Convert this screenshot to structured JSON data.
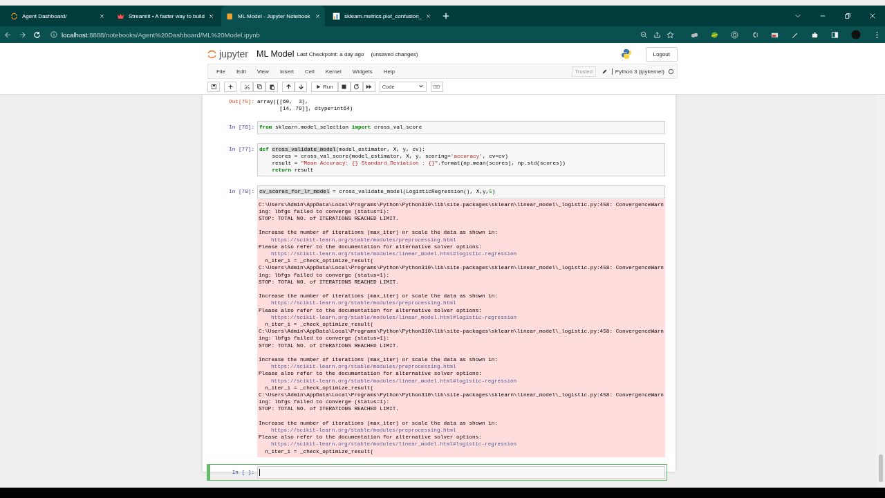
{
  "browser": {
    "tabs": [
      {
        "title": "Agent Dashboard/",
        "selected": false
      },
      {
        "title": "Streamlit • A faster way to build",
        "selected": false
      },
      {
        "title": "ML Model - Jupyter Notebook",
        "selected": true
      },
      {
        "title": "sklearn.metrics.plot_confusion_",
        "selected": false
      }
    ],
    "address": {
      "host": "localhost",
      "path": ":8888/notebooks/Agent%20Dashboard/ML%20Model.ipynb"
    }
  },
  "notebook": {
    "logo": "jupyter",
    "name": "ML Model",
    "checkpoint": "Last Checkpoint: a day ago",
    "unsaved": "(unsaved changes)",
    "logout": "Logout",
    "menu": [
      "File",
      "Edit",
      "View",
      "Insert",
      "Cell",
      "Kernel",
      "Widgets",
      "Help"
    ],
    "trusted": "Trusted",
    "kernel": "Python 3 (ipykernel)",
    "run": "Run",
    "cell_type": "Code"
  },
  "cells": [
    {
      "kind": "output",
      "prompt": "Out[75]:",
      "lines": [
        "array([[60,  3],",
        "       [14, 79]], dtype=int64)"
      ]
    },
    {
      "kind": "code",
      "prompt": "In [76]:",
      "selected": false,
      "lines": [
        [
          {
            "kind": "kw",
            "text": "from"
          },
          {
            "kind": "plain",
            "text": " sklearn.model_selection "
          },
          {
            "kind": "kw",
            "text": "import"
          },
          {
            "kind": "plain",
            "text": " cross_val_score"
          }
        ]
      ]
    },
    {
      "kind": "code",
      "prompt": "In [77]:",
      "selected": false,
      "lines": [
        [
          {
            "kind": "kw",
            "text": "def "
          },
          {
            "kind": "mark",
            "text": "cross_validate_model"
          },
          {
            "kind": "plain",
            "text": "(model_estimator, X, y, cv):"
          }
        ],
        [
          {
            "kind": "plain",
            "text": "    scores = cross_val_score(model_estimator, X, y, scoring="
          },
          {
            "kind": "str",
            "text": "'accuracy'"
          },
          {
            "kind": "plain",
            "text": ", cv=cv)"
          }
        ],
        [
          {
            "kind": "plain",
            "text": "    result = "
          },
          {
            "kind": "str",
            "text": "\"Mean Accuracy: {} Standard_Deviation : {}\""
          },
          {
            "kind": "plain",
            "text": ".format(np.mean(scores), np.std(scores))"
          }
        ],
        [
          {
            "kind": "kw",
            "text": "    return"
          },
          {
            "kind": "plain",
            "text": " result"
          }
        ]
      ]
    },
    {
      "kind": "code",
      "prompt": "In [78]:",
      "selected": false,
      "lines": [
        [
          {
            "kind": "mark",
            "text": "cv_scores_for_lr_model"
          },
          {
            "kind": "plain",
            "text": " = cross_validate_model(LogisticRegression(), X,y,"
          },
          {
            "kind": "num",
            "text": "5"
          },
          {
            "kind": "plain",
            "text": ")"
          }
        ]
      ],
      "stderr": [
        {
          "kind": "text",
          "text": "C:\\Users\\Admin\\AppData\\Local\\Programs\\Python\\Python310\\lib\\site-packages\\sklearn\\linear_model\\_logistic.py:458: ConvergenceWarn"
        },
        {
          "kind": "text",
          "text": "ing: lbfgs failed to converge (status=1):"
        },
        {
          "kind": "text",
          "text": "STOP: TOTAL NO. of ITERATIONS REACHED LIMIT."
        },
        {
          "kind": "spaced",
          "text": "Increase the number of iterations (max_iter) or scale the data as shown in:"
        },
        {
          "kind": "link",
          "text": "https://scikit-learn.org/stable/modules/preprocessing.html"
        },
        {
          "kind": "text",
          "text": "Please also refer to the documentation for alternative solver options:"
        },
        {
          "kind": "link",
          "text": "https://scikit-learn.org/stable/modules/linear_model.html#logistic-regression"
        },
        {
          "kind": "text",
          "text": "  n_iter_i = _check_optimize_result("
        },
        {
          "kind": "text",
          "text": "C:\\Users\\Admin\\AppData\\Local\\Programs\\Python\\Python310\\lib\\site-packages\\sklearn\\linear_model\\_logistic.py:458: ConvergenceWarn"
        },
        {
          "kind": "text",
          "text": "ing: lbfgs failed to converge (status=1):"
        },
        {
          "kind": "text",
          "text": "STOP: TOTAL NO. of ITERATIONS REACHED LIMIT."
        },
        {
          "kind": "spaced",
          "text": "Increase the number of iterations (max_iter) or scale the data as shown in:"
        },
        {
          "kind": "link",
          "text": "https://scikit-learn.org/stable/modules/preprocessing.html"
        },
        {
          "kind": "text",
          "text": "Please also refer to the documentation for alternative solver options:"
        },
        {
          "kind": "link",
          "text": "https://scikit-learn.org/stable/modules/linear_model.html#logistic-regression"
        },
        {
          "kind": "text",
          "text": "  n_iter_i = _check_optimize_result("
        },
        {
          "kind": "text",
          "text": "C:\\Users\\Admin\\AppData\\Local\\Programs\\Python\\Python310\\lib\\site-packages\\sklearn\\linear_model\\_logistic.py:458: ConvergenceWarn"
        },
        {
          "kind": "text",
          "text": "ing: lbfgs failed to converge (status=1):"
        },
        {
          "kind": "text",
          "text": "STOP: TOTAL NO. of ITERATIONS REACHED LIMIT."
        },
        {
          "kind": "spaced",
          "text": "Increase the number of iterations (max_iter) or scale the data as shown in:"
        },
        {
          "kind": "link",
          "text": "https://scikit-learn.org/stable/modules/preprocessing.html"
        },
        {
          "kind": "text",
          "text": "Please also refer to the documentation for alternative solver options:"
        },
        {
          "kind": "link",
          "text": "https://scikit-learn.org/stable/modules/linear_model.html#logistic-regression"
        },
        {
          "kind": "text",
          "text": "  n_iter_i = _check_optimize_result("
        },
        {
          "kind": "text",
          "text": "C:\\Users\\Admin\\AppData\\Local\\Programs\\Python\\Python310\\lib\\site-packages\\sklearn\\linear_model\\_logistic.py:458: ConvergenceWarn"
        },
        {
          "kind": "text",
          "text": "ing: lbfgs failed to converge (status=1):"
        },
        {
          "kind": "text",
          "text": "STOP: TOTAL NO. of ITERATIONS REACHED LIMIT."
        },
        {
          "kind": "spaced",
          "text": "Increase the number of iterations (max_iter) or scale the data as shown in:"
        },
        {
          "kind": "link",
          "text": "https://scikit-learn.org/stable/modules/preprocessing.html"
        },
        {
          "kind": "text",
          "text": "Please also refer to the documentation for alternative solver options:"
        },
        {
          "kind": "link",
          "text": "https://scikit-learn.org/stable/modules/linear_model.html#logistic-regression"
        },
        {
          "kind": "text",
          "text": "  n_iter_i = _check_optimize_result("
        }
      ]
    },
    {
      "kind": "code",
      "prompt": "In [ ]:",
      "selected": true
    }
  ]
}
